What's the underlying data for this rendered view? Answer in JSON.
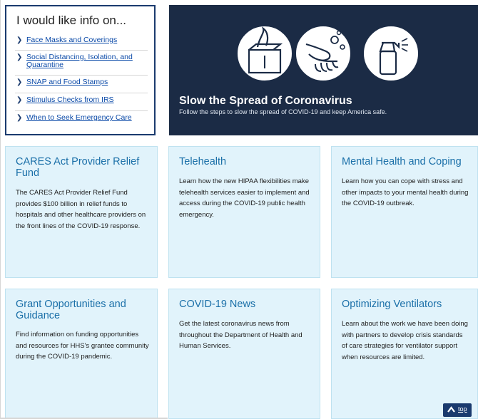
{
  "info_panel": {
    "title": "I would like info on...",
    "links": [
      {
        "label": "Face Masks and Coverings"
      },
      {
        "label": "Social Distancing, Isolation, and Quarantine"
      },
      {
        "label": "SNAP and Food Stamps"
      },
      {
        "label": "Stimulus Checks from IRS"
      },
      {
        "label": "When to Seek Emergency Care"
      }
    ]
  },
  "hero": {
    "title": "Slow the Spread of Coronavirus",
    "subtitle": "Follow the steps to slow the spread of COVID-19 and keep America safe.",
    "icons": [
      "tissue-box-icon",
      "hand-washing-icon",
      "spray-bottle-icon"
    ],
    "background_color": "#1b2b45"
  },
  "cards": [
    {
      "title": "CARES Act Provider Relief Fund",
      "body": "The CARES Act Provider Relief Fund provides $100 billion in relief funds to hospitals and other healthcare providers on the front lines of the COVID-19 response."
    },
    {
      "title": "Telehealth",
      "body": "Learn how the new HIPAA flexibilities make telehealth services easier to implement and access during the COVID-19 public health emergency."
    },
    {
      "title": "Mental Health and Coping",
      "body": "Learn how you can cope with stress and other impacts to your mental health during the COVID-19 outbreak."
    },
    {
      "title": "Grant Opportunities and Guidance",
      "body": "Find information on funding opportunities and resources for HHS's grantee community during the COVID-19 pandemic."
    },
    {
      "title": "COVID-19 News",
      "body": "Get the latest coronavirus news from throughout the Department of Health and Human Services."
    },
    {
      "title": "Optimizing Ventilators",
      "body": "Learn about the work we have been doing with partners to develop crisis standards of care strategies for ventilator support when resources are limited."
    }
  ],
  "top_button": {
    "label": "top"
  },
  "colors": {
    "card_bg": "#e1f3fb",
    "card_title": "#1a6fa8",
    "link": "#0b4aa8",
    "navy": "#1a3a6e"
  }
}
